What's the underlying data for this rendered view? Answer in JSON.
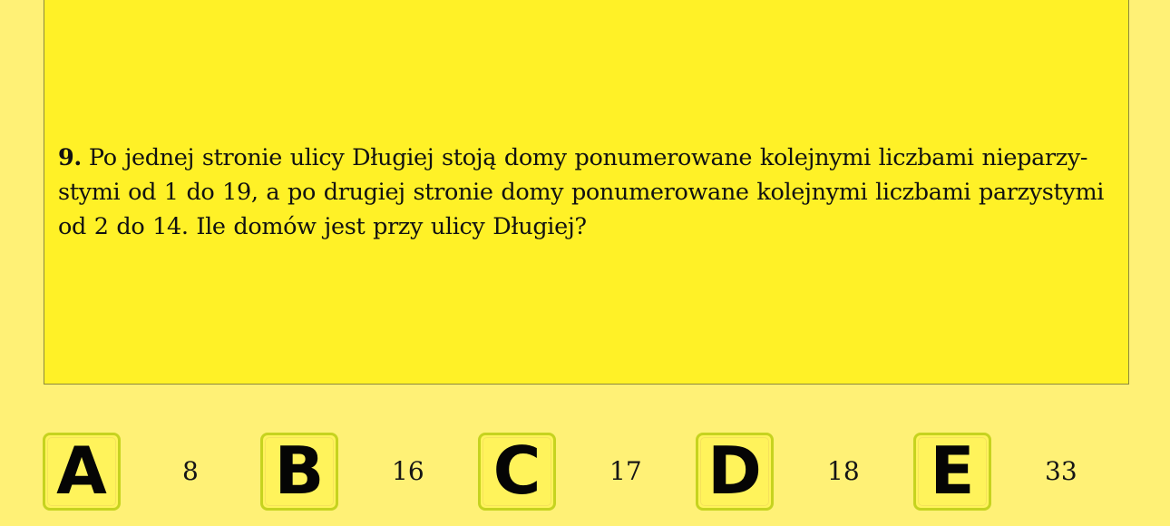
{
  "question": {
    "number": "9.",
    "lines": [
      "Po jednej stronie ulicy Długiej stoją domy ponumerowane kolejnymi liczbami nieparzy-",
      "stymi od 1 do 19, a po drugiej stronie domy ponumerowane kolejnymi liczbami parzystymi",
      "od 2 do 14. Ile domów jest przy ulicy Długiej?"
    ]
  },
  "answers": [
    {
      "letter": "A",
      "value": "8"
    },
    {
      "letter": "B",
      "value": "16"
    },
    {
      "letter": "C",
      "value": "17"
    },
    {
      "letter": "D",
      "value": "18"
    },
    {
      "letter": "E",
      "value": "33"
    }
  ],
  "colors": {
    "page_background": "#fff176",
    "question_background": "#fff127",
    "answer_box_background": "#fff35b",
    "answer_box_border": "#c6d31f"
  }
}
